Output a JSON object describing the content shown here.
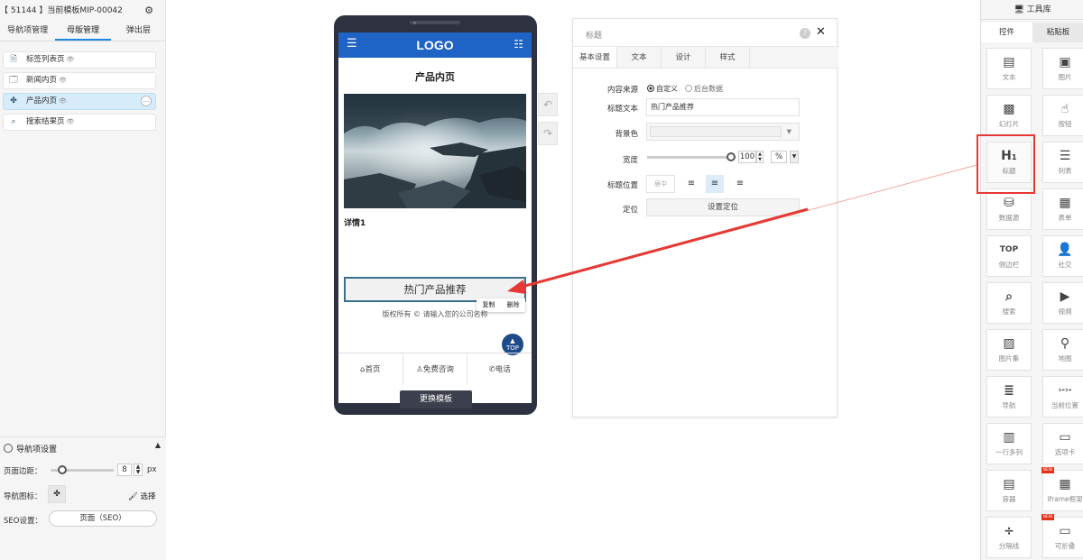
{
  "left_panel": {
    "title": "【 51144 】当前模板MIP-00042",
    "tabs": [
      "导航项管理",
      "母版管理",
      "弹出层"
    ],
    "pages": [
      {
        "label": "标签列表页",
        "icon": "document-icon"
      },
      {
        "label": "新闻内页",
        "icon": "browser-window-icon"
      },
      {
        "label": "产品内页",
        "icon": "grid-pinwheel-icon",
        "active": true
      },
      {
        "label": "搜索结果页",
        "icon": "search-icon"
      }
    ],
    "more_label": "...",
    "nav_settings": {
      "heading": "导航项设置",
      "margin_label": "页面边距：",
      "margin_value": "8",
      "margin_unit": "px",
      "icon_label": "导航图标：",
      "pick_label": "选择",
      "seo_label": "SEO设置：",
      "seo_button": "页面（SEO）"
    }
  },
  "phone": {
    "logo": "LOGO",
    "page_title": "产品内页",
    "detail": "详情1",
    "hot_button": "热门产品推荐",
    "ctx_copy": "复制",
    "ctx_delete": "删除",
    "copyright": "版权所有 © 请输入您的公司名称",
    "top_label": "TOP",
    "bottom_nav": [
      "首页",
      "免费咨询",
      "电话"
    ],
    "change_template": "更换模板"
  },
  "properties": {
    "title": "标题",
    "help": "?",
    "tabs": [
      "基本设置",
      "文本",
      "设计",
      "样式"
    ],
    "content_source_label": "内容来源",
    "source_custom": "自定义",
    "source_backend": "后台数据",
    "title_text_label": "标题文本",
    "title_text_value": "热门产品推荐",
    "bg_color_label": "背景色",
    "width_label": "宽度",
    "width_value": "100",
    "width_unit": "%",
    "width_fill": 1.0,
    "position_label": "标题位置",
    "position_center_placeholder": "居中",
    "locate_label": "定位",
    "locate_button": "设置定位"
  },
  "toolbox": {
    "title": "工具库",
    "tabs": [
      "控件",
      "粘贴板"
    ],
    "tools": [
      {
        "label": "文本",
        "icon": "text-doc-icon",
        "glyph": "▤"
      },
      {
        "label": "图片",
        "icon": "image-icon",
        "glyph": "▣"
      },
      {
        "label": "幻灯片",
        "icon": "slideshow-icon",
        "glyph": "▩"
      },
      {
        "label": "按钮",
        "icon": "pointer-hand-icon",
        "glyph": "☝"
      },
      {
        "label": "标题",
        "icon": "heading-h1-icon",
        "glyph": "H₁",
        "highlighted": true
      },
      {
        "label": "列表",
        "icon": "list-icon",
        "glyph": "☰"
      },
      {
        "label": "数据源",
        "icon": "database-icon",
        "glyph": "⛁"
      },
      {
        "label": "表单",
        "icon": "form-icon",
        "glyph": "▦"
      },
      {
        "label": "侧边栏",
        "icon": "top-sidebar-icon",
        "glyph": "TOP"
      },
      {
        "label": "社交",
        "icon": "user-add-icon",
        "glyph": "👤"
      },
      {
        "label": "搜索",
        "icon": "search-box-icon",
        "glyph": "⌕"
      },
      {
        "label": "视频",
        "icon": "video-icon",
        "glyph": "▶"
      },
      {
        "label": "图片集",
        "icon": "gallery-icon",
        "glyph": "▨"
      },
      {
        "label": "地图",
        "icon": "map-icon",
        "glyph": "⚲"
      },
      {
        "label": "导航",
        "icon": "nav-menu-icon",
        "glyph": "≣"
      },
      {
        "label": "当前位置",
        "icon": "breadcrumb-icon",
        "glyph": "›-›-"
      },
      {
        "label": "一行多列",
        "icon": "columns-icon",
        "glyph": "▥"
      },
      {
        "label": "选项卡",
        "icon": "tabs-icon",
        "glyph": "▭"
      },
      {
        "label": "容器",
        "icon": "container-icon",
        "glyph": "▤"
      },
      {
        "label": "iframe框架",
        "icon": "iframe-icon",
        "glyph": "▦",
        "badge": "NEW"
      },
      {
        "label": "分隔线",
        "icon": "divider-icon",
        "glyph": "÷"
      },
      {
        "label": "可折叠",
        "icon": "collapse-icon",
        "glyph": "▭",
        "badge": "NEW"
      }
    ]
  },
  "colors": {
    "header_blue": "#1f63c4",
    "annotation_red": "#e53935",
    "active_page_bg": "#d6ecfb"
  }
}
